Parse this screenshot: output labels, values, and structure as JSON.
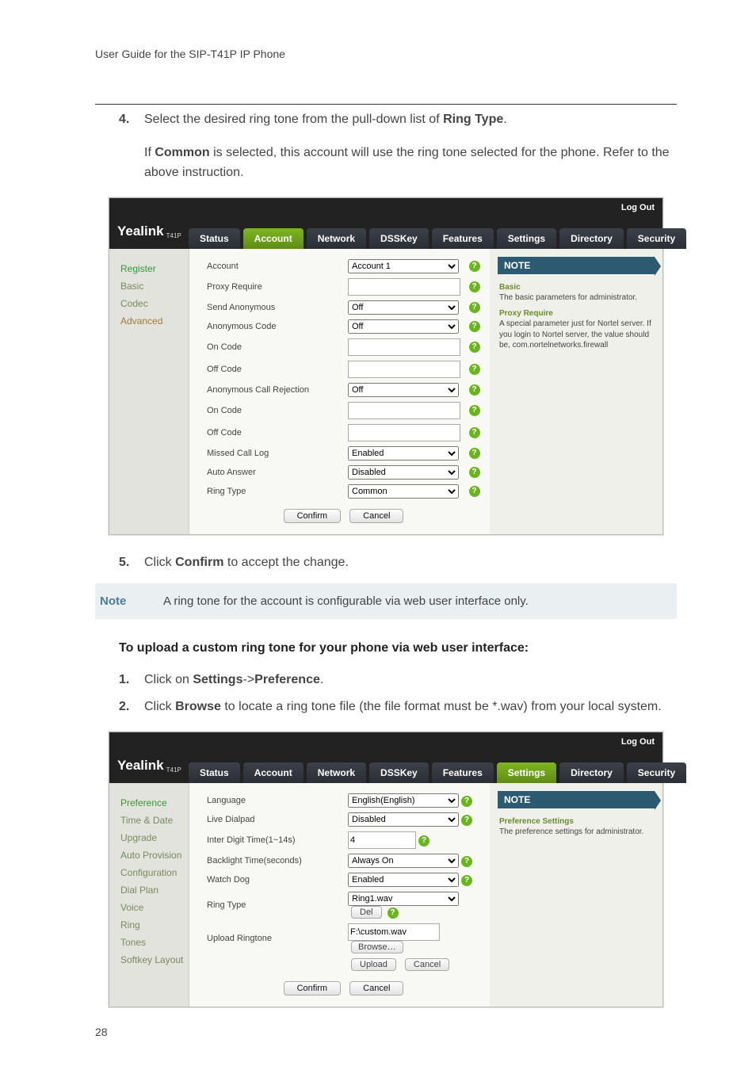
{
  "header": {
    "title": "User Guide for the SIP-T41P IP Phone"
  },
  "step4": {
    "num": "4.",
    "text_before": "Select the desired ring tone from the pull-down list of ",
    "bold": "Ring Type",
    "text_after": ".",
    "para2_a": "If ",
    "para2_bold": "Common",
    "para2_b": " is selected, this account will use the ring tone selected for the phone. Refer to the above instruction."
  },
  "step5": {
    "num": "5.",
    "a": "Click ",
    "bold": "Confirm",
    "b": " to accept the change."
  },
  "note_bar": {
    "label": "Note",
    "text": "A ring tone for the account is configurable via web user interface only."
  },
  "section2_title": "To upload a custom ring tone for your phone via web user interface:",
  "step1b": {
    "num": "1.",
    "a": "Click on ",
    "b1": "Settings",
    "arrow": "->",
    "b2": "Preference",
    "c": "."
  },
  "step2b": {
    "num": "2.",
    "a": "Click ",
    "bold": "Browse",
    "b": " to locate a ring tone file (the file format must be *.wav) from your local system."
  },
  "logo": {
    "main": "Yealink",
    "sub": "T41P"
  },
  "logout": "Log Out",
  "tabs": [
    "Status",
    "Account",
    "Network",
    "DSSKey",
    "Features",
    "Settings",
    "Directory",
    "Security"
  ],
  "shot1": {
    "side": [
      "Register",
      "Basic",
      "Codec",
      "Advanced"
    ],
    "rows": [
      {
        "label": "Account",
        "value": "Account 1",
        "type": "select"
      },
      {
        "label": "Proxy Require",
        "value": "",
        "type": "text"
      },
      {
        "label": "Send Anonymous",
        "value": "Off",
        "type": "select"
      },
      {
        "label": "Anonymous Code",
        "value": "Off",
        "type": "select"
      },
      {
        "label": "On Code",
        "value": "",
        "type": "text"
      },
      {
        "label": "Off Code",
        "value": "",
        "type": "text"
      },
      {
        "label": "Anonymous Call Rejection",
        "value": "Off",
        "type": "select"
      },
      {
        "label": "On Code",
        "value": "",
        "type": "text"
      },
      {
        "label": "Off Code",
        "value": "",
        "type": "text"
      },
      {
        "label": "Missed Call Log",
        "value": "Enabled",
        "type": "select"
      },
      {
        "label": "Auto Answer",
        "value": "Disabled",
        "type": "select"
      },
      {
        "label": "Ring Type",
        "value": "Common",
        "type": "select"
      }
    ],
    "confirm": "Confirm",
    "cancel": "Cancel",
    "note_title": "NOTE",
    "note_h1": "Basic",
    "note_t1": "The basic parameters for administrator.",
    "note_h2": "Proxy Require",
    "note_t2": "A special parameter just for Nortel server. If you login to Nortel server, the value should be, com.nortelnetworks.firewall"
  },
  "shot2": {
    "side": [
      "Preference",
      "Time & Date",
      "Upgrade",
      "Auto Provision",
      "Configuration",
      "Dial Plan",
      "Voice",
      "Ring",
      "Tones",
      "Softkey Layout"
    ],
    "rows": [
      {
        "label": "Language",
        "value": "English(English)",
        "type": "select"
      },
      {
        "label": "Live Dialpad",
        "value": "Disabled",
        "type": "select"
      },
      {
        "label": "Inter Digit Time(1~14s)",
        "value": "4",
        "type": "text_short"
      },
      {
        "label": "Backlight Time(seconds)",
        "value": "Always On",
        "type": "select"
      },
      {
        "label": "Watch Dog",
        "value": "Enabled",
        "type": "select"
      },
      {
        "label": "Ring Type",
        "value": "Ring1.wav",
        "type": "select",
        "extra": "Del"
      },
      {
        "label": "Upload Ringtone",
        "value": "F:\\custom.wav",
        "type": "file"
      }
    ],
    "upload": "Upload",
    "cancel_small": "Cancel",
    "browse": "Browse…",
    "confirm": "Confirm",
    "cancel": "Cancel",
    "note_title": "NOTE",
    "note_h1": "Preference Settings",
    "note_t1": "The preference settings for administrator."
  },
  "page_number": "28"
}
